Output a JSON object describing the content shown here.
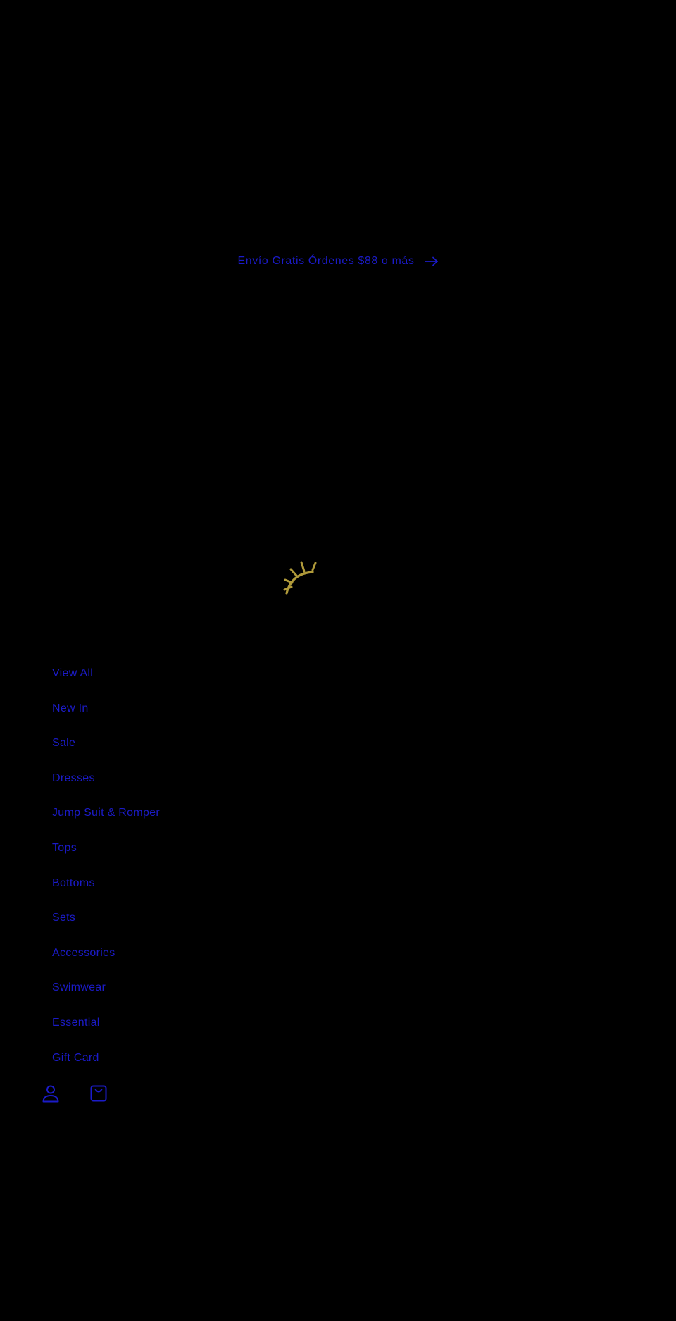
{
  "announcement": {
    "text": "Envío Gratis Órdenes $88 o más",
    "arrow_icon": "arrow-right-icon"
  },
  "logo": {
    "icon": "sun-logo",
    "color": "#b09a3a"
  },
  "menu": {
    "items": [
      {
        "label": "View All"
      },
      {
        "label": "New In"
      },
      {
        "label": "Sale"
      },
      {
        "label": "Dresses"
      },
      {
        "label": "Jump Suit & Romper"
      },
      {
        "label": "Tops"
      },
      {
        "label": "Bottoms"
      },
      {
        "label": "Sets"
      },
      {
        "label": "Accessories"
      },
      {
        "label": "Swimwear"
      },
      {
        "label": "Essential"
      },
      {
        "label": "Gift Card"
      }
    ]
  },
  "utility": {
    "account_icon": "account-icon",
    "cart_icon": "cart-icon"
  },
  "colors": {
    "background": "#000000",
    "link": "#1b1bc8",
    "logo": "#b09a3a"
  }
}
